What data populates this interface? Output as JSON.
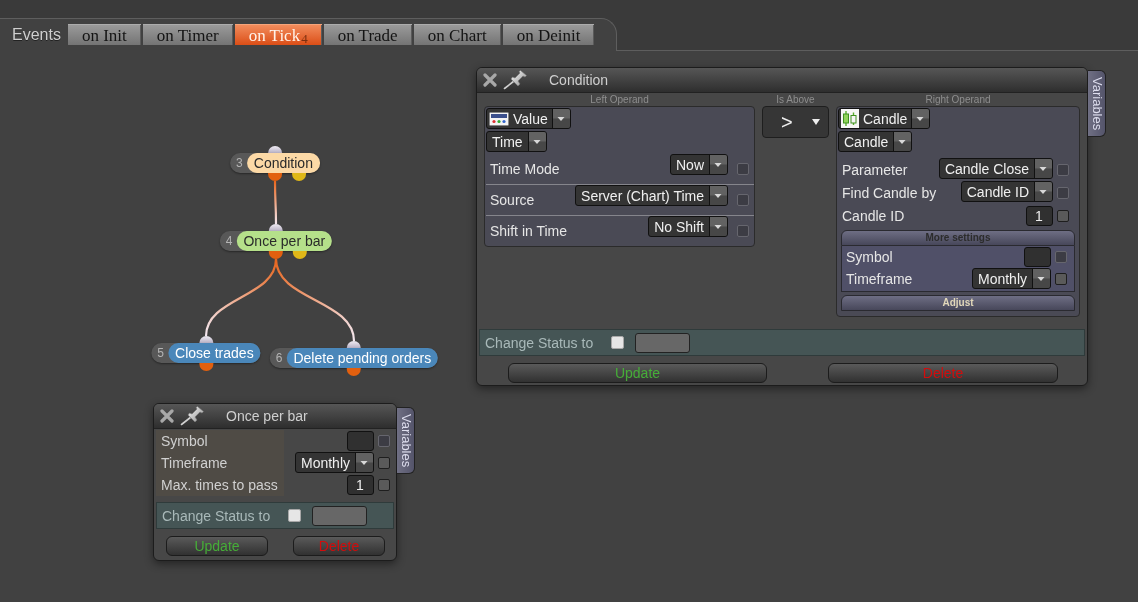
{
  "events": {
    "label": "Events",
    "tabs": [
      {
        "label": "on Init",
        "selected": false
      },
      {
        "label": "on Timer",
        "selected": false
      },
      {
        "label": "on Tick",
        "selected": true,
        "badge": "4"
      },
      {
        "label": "on Trade",
        "selected": false
      },
      {
        "label": "on Chart",
        "selected": false
      },
      {
        "label": "on Deinit",
        "selected": false
      }
    ]
  },
  "flow": {
    "nodes": [
      {
        "number": "3",
        "label": "Condition",
        "kind": "condition",
        "color": "#fcd9a6",
        "children": [
          {
            "number": "4",
            "label": "Once per bar",
            "kind": "condition",
            "color": "#b5e08a",
            "children": [
              {
                "number": "5",
                "label": "Close trades",
                "kind": "action",
                "color": "#4a87ba"
              },
              {
                "number": "6",
                "label": "Delete pending orders",
                "kind": "action",
                "color": "#4a87ba"
              }
            ]
          }
        ]
      }
    ]
  },
  "condition_window": {
    "title": "Condition",
    "side_tab": "Variables",
    "operands": [
      {
        "heading": "Left Operand",
        "type": "Value",
        "subtype": "Time",
        "rows": [
          {
            "kind": "dropdown",
            "label": "Time Mode",
            "value": "Now",
            "check_disabled": true
          },
          {
            "kind": "dropdown",
            "label": "Source",
            "value": "Server (Chart) Time",
            "check_disabled": true
          },
          {
            "kind": "dropdown",
            "label": "Shift in Time",
            "value": "No Shift",
            "check_disabled": true
          }
        ]
      },
      {
        "heading": "Right Operand",
        "type": "Candle",
        "subtype": "Candle",
        "rows": [
          {
            "kind": "dropdown",
            "label": "Parameter",
            "value": "Candle Close",
            "check_disabled": true
          },
          {
            "kind": "dropdown",
            "label": "Find Candle by",
            "value": "Candle ID",
            "check_disabled": true
          },
          {
            "kind": "input",
            "label": "Candle ID",
            "value": "1",
            "check_disabled": false
          }
        ],
        "sections": [
          {
            "title": "More settings",
            "expanded": true,
            "rows": [
              {
                "kind": "input",
                "label": "Symbol",
                "check_disabled": true
              },
              {
                "kind": "dropdown",
                "label": "Timeframe",
                "value": "Monthly",
                "check_disabled": false
              }
            ]
          },
          {
            "title": "Adjust",
            "expanded": false
          }
        ]
      }
    ],
    "operator": {
      "heading": "Is Above",
      "symbol": ">"
    },
    "status": {
      "label": "Change Status to",
      "checked": false
    },
    "buttons": [
      {
        "label": "Update",
        "kind": "update"
      },
      {
        "label": "Delete",
        "kind": "delete"
      }
    ]
  },
  "once_window": {
    "title": "Once per bar",
    "side_tab": "Variables",
    "rows": [
      {
        "kind": "input",
        "label": "Symbol",
        "check_disabled": true
      },
      {
        "kind": "dropdown",
        "label": "Timeframe",
        "value": "Monthly",
        "check_disabled": false
      },
      {
        "kind": "input",
        "label": "Max. times to pass",
        "value": "1",
        "check_disabled": false
      }
    ],
    "status": {
      "label": "Change Status to",
      "checked": false
    },
    "buttons": [
      {
        "label": "Update",
        "kind": "update"
      },
      {
        "label": "Delete",
        "kind": "delete"
      }
    ]
  }
}
